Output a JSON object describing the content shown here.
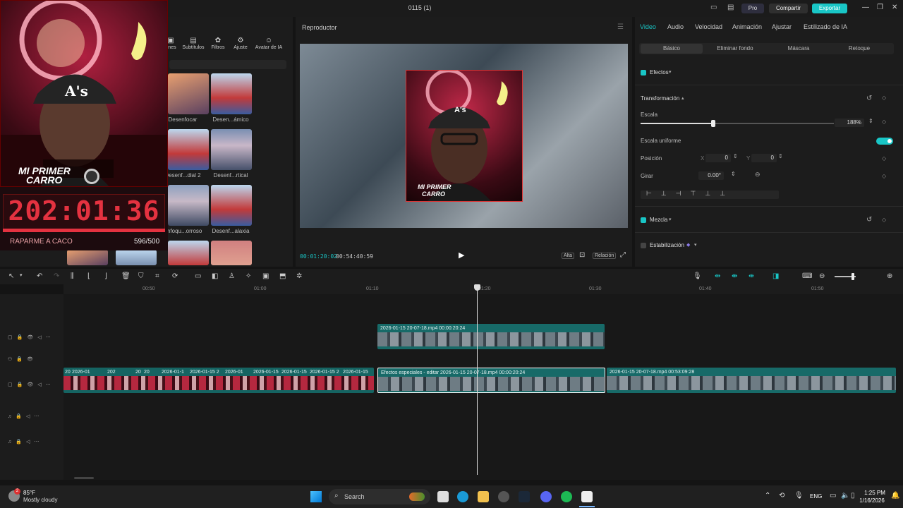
{
  "titlebar": {
    "title": "0115 (1)",
    "pro_label": "Pro",
    "share_label": "Compartir",
    "export_label": "Exportar"
  },
  "media_tabs": [
    {
      "label": "ones",
      "icon": "media-icon"
    },
    {
      "label": "Subtítulos",
      "icon": "subtitle-icon"
    },
    {
      "label": "Filtros",
      "icon": "filter-icon"
    },
    {
      "label": "Ajuste",
      "icon": "adjust-icon"
    },
    {
      "label": "Avatar de IA",
      "icon": "avatar-icon"
    }
  ],
  "media_items": [
    {
      "label": "Desenfocar"
    },
    {
      "label": "Desen...ámico"
    },
    {
      "label": "Desenf...dial 2"
    },
    {
      "label": "Desenf...rtical"
    },
    {
      "label": "Enfoqu...orroso"
    },
    {
      "label": "Desenf...alaxia"
    }
  ],
  "overlay": {
    "timer": "202:01:36",
    "goal_label": "RAPARME A CACO",
    "goal_count": "596/500",
    "goal_fraction": 1.0,
    "banner_line1": "MI PRIMER",
    "banner_line2": "CARRO",
    "cap_logo": "A's"
  },
  "player": {
    "title": "Reproductor",
    "current_time": "00:01:20:02",
    "total_time": "00:54:40:59",
    "quality_label": "Alta",
    "ratio_label": "Relación"
  },
  "inspector": {
    "tabs": [
      "Video",
      "Audio",
      "Velocidad",
      "Animación",
      "Ajustar",
      "Estilizado de IA"
    ],
    "subtabs": [
      "Básico",
      "Eliminar fondo",
      "Máscara",
      "Retoque"
    ],
    "effects_label": "Efectos",
    "transform_label": "Transformación",
    "scale_label": "Escala",
    "scale_value": "188%",
    "scale_fraction": 0.376,
    "uniform_label": "Escala uniforme",
    "position_label": "Posición",
    "pos_x_label": "X",
    "pos_x_value": "0",
    "pos_y_label": "Y",
    "pos_y_value": "0",
    "rotate_label": "Girar",
    "rotate_value": "0.00°",
    "blend_label": "Mezcla",
    "stabilize_label": "Estabilización"
  },
  "timeline": {
    "ticks": [
      "00:50",
      "01:00",
      "01:10",
      "01:20",
      "01:30",
      "01:40",
      "01:50"
    ],
    "upper_clip_label": "2026-01-15 20-07-18.mp4   00:00:20:24",
    "main_clip_label": "Efectos especiales - editar   2026-01-15 20-07-18.mp4   00:00:20:24",
    "right_clip_label": "2026-01-15 20-07-18.mp4   00:53:09:28",
    "left_clip_labels": [
      "20",
      "2026-01",
      "202",
      "20",
      "20",
      "2026-01-1",
      "2026-01-15 2",
      "2026-01",
      "2026-01-15",
      "2026-01-15",
      "2026-01-15 2",
      "2026-01-15"
    ]
  },
  "taskbar": {
    "weather_temp": "85°F",
    "weather_desc": "Mostly cloudy",
    "search_label": "Search",
    "lang": "ENG",
    "time": "1:25 PM",
    "date": "1/16/2026"
  },
  "colors": {
    "accent": "#19c6c6",
    "overlay_red": "#e43240",
    "clip_teal": "#176a68"
  }
}
